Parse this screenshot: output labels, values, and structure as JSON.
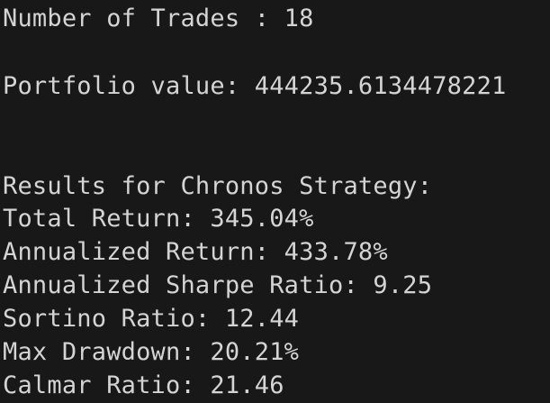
{
  "terminal": {
    "lines": {
      "trades": "Number of Trades : 18",
      "portfolio": "Portfolio value: 444235.6134478221",
      "results_header": "Results for Chronos Strategy:",
      "total_return": "Total Return: 345.04%",
      "annualized_return": "Annualized Return: 433.78%",
      "sharpe": "Annualized Sharpe Ratio: 9.25",
      "sortino": "Sortino Ratio: 12.44",
      "max_drawdown": "Max Drawdown: 20.21%",
      "calmar": "Calmar Ratio: 21.46"
    },
    "colors": {
      "background": "#181818",
      "text": "#d4d4d4"
    }
  }
}
